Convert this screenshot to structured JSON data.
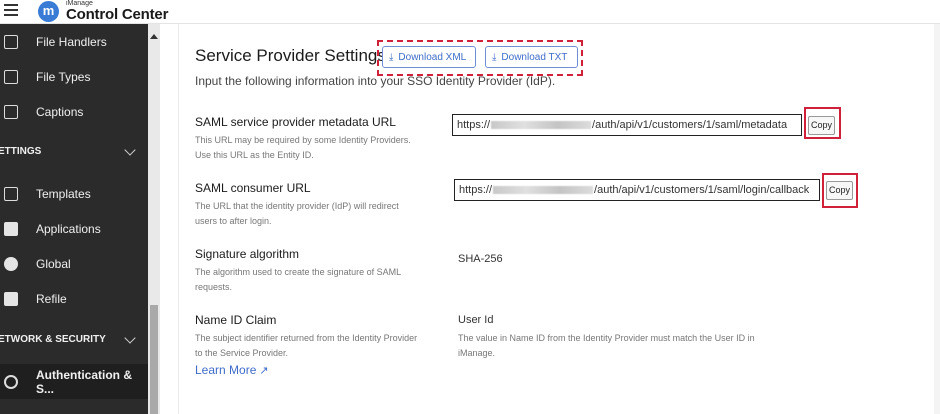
{
  "header": {
    "logo_letter": "m",
    "logo_sub": "iManage",
    "logo_main": "Control Center"
  },
  "sidebar": {
    "items_top": [
      {
        "label": "File Handlers",
        "icon": "file-handlers-icon"
      },
      {
        "label": "File Types",
        "icon": "file-types-icon"
      },
      {
        "label": "Captions",
        "icon": "captions-icon"
      }
    ],
    "section_settings": "ETTINGS",
    "items_settings": [
      {
        "label": "Templates",
        "icon": "templates-icon"
      },
      {
        "label": "Applications",
        "icon": "applications-icon"
      },
      {
        "label": "Global",
        "icon": "globe-icon"
      },
      {
        "label": "Refile",
        "icon": "refile-icon"
      }
    ],
    "section_network": "ETWORK & SECURITY",
    "items_network": [
      {
        "label": "Authentication & S...",
        "icon": "fingerprint-icon",
        "active": true
      }
    ]
  },
  "main": {
    "title": "Service Provider Settings",
    "download_xml": "Download XML",
    "download_txt": "Download TXT",
    "subtitle": "Input the following information into your SSO Identity Provider (IdP).",
    "metadata": {
      "title": "SAML service provider metadata URL",
      "desc": "This URL may be required by some Identity Providers. Use this URL as the Entity ID.",
      "url_prefix": "https://",
      "url_suffix": "/auth/api/v1/customers/1/saml/metadata",
      "copy": "Copy"
    },
    "consumer": {
      "title": "SAML consumer URL",
      "desc": "The URL that the identity provider (IdP) will redirect users to after login.",
      "url_prefix": "https://",
      "url_suffix": "/auth/api/v1/customers/1/saml/login/callback",
      "copy": "Copy"
    },
    "signature": {
      "title": "Signature algorithm",
      "desc": "The algorithm used to create the signature of SAML requests.",
      "value": "SHA-256"
    },
    "nameid": {
      "title": "Name ID Claim",
      "desc": "The subject identifier returned from the Identity Provider to the Service Provider.",
      "value": "User Id",
      "value_desc": "The value in Name ID from the Identity Provider must match the User ID in iManage."
    },
    "learn_more": "Learn More",
    "accent_color": "#3f6cc9",
    "highlight_color": "#d0203a"
  }
}
